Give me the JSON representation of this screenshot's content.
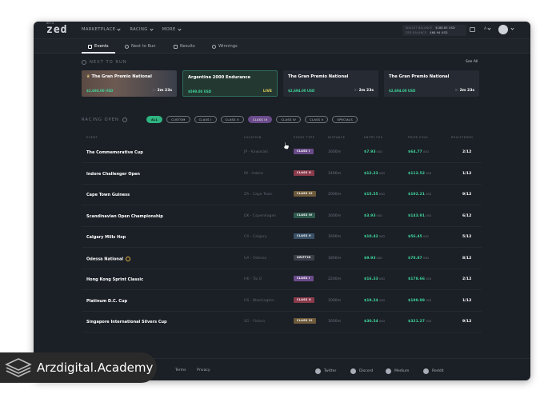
{
  "app": {
    "logo_text": "zed",
    "logo_badge": "BETA"
  },
  "nav": {
    "items": [
      {
        "label": "MARKETPLACE"
      },
      {
        "label": "RACING"
      },
      {
        "label": "MORE"
      }
    ]
  },
  "wallet": {
    "wallet_label": "WALLET BALANCE",
    "wallet_value": "$188.65 USD",
    "zed_label": "ZED BALANCE",
    "zed_value": "$68.94 USD",
    "language": "A"
  },
  "subnav": {
    "tabs": [
      {
        "label": "Events",
        "active": true
      },
      {
        "label": "Next to Run"
      },
      {
        "label": "Results"
      },
      {
        "label": "Winnings"
      }
    ]
  },
  "next_to_run": {
    "title": "NEXT TO RUN",
    "see_all": "See All",
    "cards": [
      {
        "name": "The Gran Premio National",
        "prize": "$2,694.00 USD",
        "time_prefix": "in",
        "time": "2m 23s"
      },
      {
        "name": "Argentine 2000 Endurance",
        "prize": "$599.00 USD",
        "status": "LIVE"
      },
      {
        "name": "The Gran Premio National",
        "prize": "$2,694.00 USD",
        "time_prefix": "in",
        "time": "2m 23s"
      },
      {
        "name": "The Gran Premio National",
        "prize": "$2,694.00 USD",
        "time_prefix": "in",
        "time": "2m 23s"
      }
    ]
  },
  "racing_open": {
    "title": "RACING OPEN",
    "filters": [
      "ALL",
      "CUSTOM",
      "CLASS I",
      "CLASS II",
      "CLASS III",
      "CLASS IV",
      "CLASS V",
      "SPECIALS"
    ],
    "columns": {
      "event": "EVENT",
      "location": "LOCATION",
      "event_type": "EVENT TYPE",
      "distance": "DISTANCE",
      "entry_fee": "ENTRY FEE",
      "prize_pool": "PRIZE POOL",
      "registered": "REGISTERED"
    },
    "rows": [
      {
        "event": "The Commemorative Cup",
        "location": "JP - Kawasaki",
        "type": "CLASS I",
        "type_color": "#6a4b8a",
        "distance": "1600m",
        "fee": "$7.93",
        "pool": "$64.77",
        "registered": "2/12"
      },
      {
        "event": "Indore Challenger Open",
        "location": "IN - Indore",
        "type": "CLASS II",
        "type_color": "#8a3a4a",
        "distance": "1400m",
        "fee": "$12.23",
        "pool": "$112.52",
        "registered": "1/12"
      },
      {
        "event": "Cape Town Guiness",
        "location": "ZA - Cape Town",
        "type": "CLASS III",
        "type_color": "#6e5a3a",
        "distance": "2000m",
        "fee": "$15.55",
        "pool": "$192.21",
        "registered": "9/12"
      },
      {
        "event": "Scandinavian Open Championship",
        "location": "DK - Copenhagen",
        "type": "CLASS IV",
        "type_color": "#2f5a4e",
        "distance": "1600m",
        "fee": "$3.93",
        "pool": "$143.91",
        "registered": "6/12"
      },
      {
        "event": "Calgary Mills Hop",
        "location": "CA - Calgary",
        "type": "CLASS V",
        "type_color": "#3a5268",
        "distance": "1600m",
        "fee": "$10.42",
        "pool": "$56.45",
        "registered": "5/12"
      },
      {
        "event": "Odessa National",
        "location": "UA - Odessa",
        "type": "GRIFFIN",
        "type_color": "#3a3f48",
        "distance": "1800m",
        "fee": "$9.93",
        "pool": "$78.87",
        "registered": "8/12",
        "special": true
      },
      {
        "event": "Hong Kong Sprint Classic",
        "location": "HK - Tai O",
        "type": "CLASS I",
        "type_color": "#6a4b8a",
        "distance": "2200m",
        "fee": "$16.33",
        "pool": "$178.66",
        "registered": "2/12"
      },
      {
        "event": "Platinum D.C. Cup",
        "location": "US - Washington",
        "type": "CLASS II",
        "type_color": "#8a3a4a",
        "distance": "1000m",
        "fee": "$19.24",
        "pool": "$199.99",
        "registered": "1/12"
      },
      {
        "event": "Singapore International Silvers Cup",
        "location": "SG - Yishun",
        "type": "CLASS III",
        "type_color": "#6e5a3a",
        "distance": "1600m",
        "fee": "$30.54",
        "pool": "$321.27",
        "registered": "9/12"
      }
    ],
    "currency_unit": "USD"
  },
  "footer": {
    "terms": "Terms",
    "privacy": "Privacy",
    "social": [
      {
        "label": "Twitter",
        "icon": "twitter-icon"
      },
      {
        "label": "Discord",
        "icon": "discord-icon"
      },
      {
        "label": "Medium",
        "icon": "medium-icon"
      },
      {
        "label": "Reddit",
        "icon": "reddit-icon"
      }
    ]
  },
  "watermark": {
    "text": "Arzdigital.Academy"
  }
}
